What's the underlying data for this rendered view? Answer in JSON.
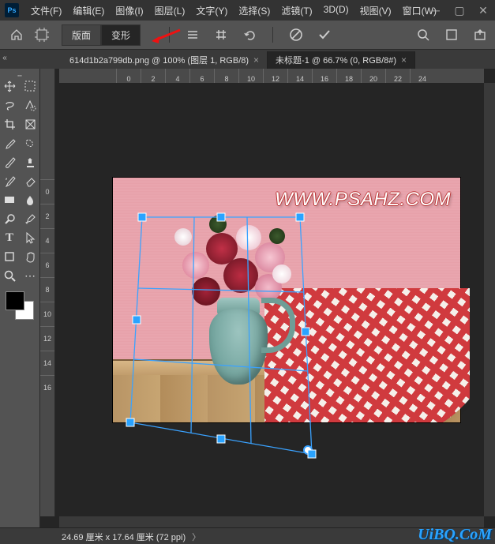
{
  "app": {
    "logo": "Ps"
  },
  "menu": {
    "file": "文件(F)",
    "edit": "编辑(E)",
    "image": "图像(I)",
    "layer": "图层(L)",
    "type": "文字(Y)",
    "select": "选择(S)",
    "filter": "滤镜(T)",
    "threeD": "3D(D)",
    "view": "视图(V)",
    "window": "窗口(W)"
  },
  "options": {
    "tab_panel": "版面",
    "tab_warp": "变形"
  },
  "tabs": {
    "doc1": "614d1b2a799db.png @ 100% (图层 1, RGB/8)",
    "doc2": "未标题-1 @ 66.7% (0, RGB/8#)"
  },
  "rulers": {
    "h": [
      "0",
      "2",
      "4",
      "6",
      "8",
      "10",
      "12",
      "14",
      "16",
      "18",
      "20",
      "22",
      "24"
    ],
    "v": [
      "0",
      "2",
      "4",
      "6",
      "8",
      "10",
      "12",
      "14",
      "16"
    ]
  },
  "canvas": {
    "watermark": "WWW.PSAHZ.COM"
  },
  "status": {
    "info": "24.69 厘米 x 17.64 厘米 (72 ppi)",
    "arrow": "〉"
  },
  "brand": "UiBQ.CoM"
}
